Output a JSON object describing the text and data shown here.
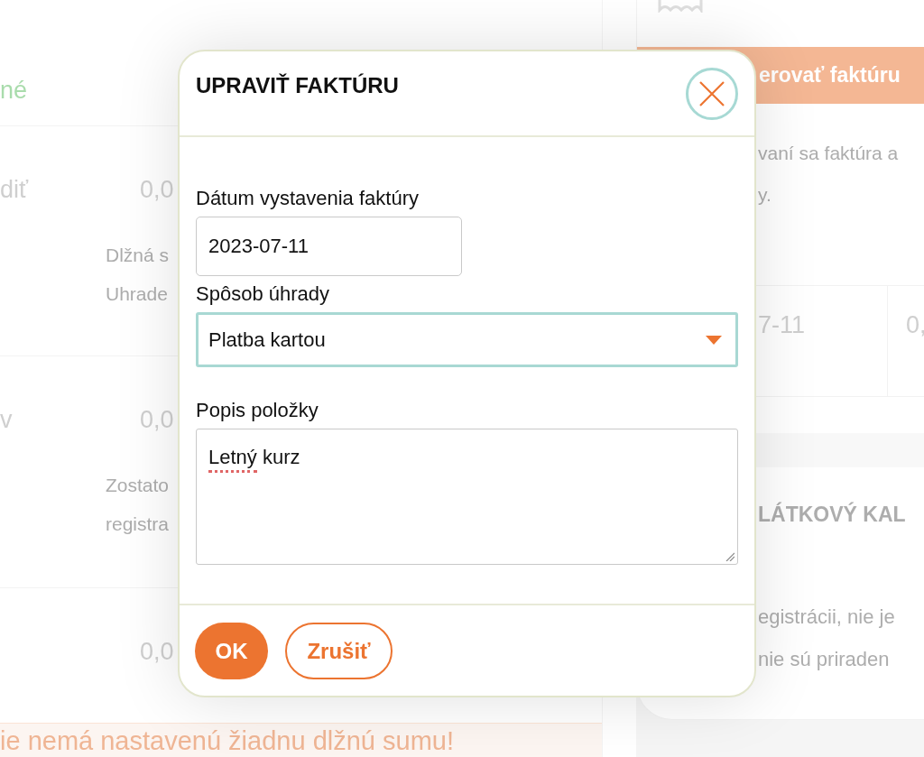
{
  "background_page": {
    "left_panel": {
      "status_label": "né",
      "rows": [
        {
          "label": "diť",
          "amount": "0,0",
          "notes": [
            "Dlžná s",
            "Uhrade"
          ]
        },
        {
          "label": "v",
          "amount": "0,0",
          "notes": [
            "Zostato",
            "registra"
          ]
        },
        {
          "amount": "0,0"
        }
      ],
      "notice": "ie nemá nastavenú žiadnu dlžnú sumu!"
    },
    "right_panel": {
      "generate_button": "erovať faktúru",
      "info_lines": [
        "vaní sa faktúra a",
        "y."
      ],
      "table_row": [
        "7-11",
        "0,"
      ],
      "section_title": "LÁTKOVÝ KAL",
      "section_lines": [
        "egistrácii, nie je",
        "nie sú priraden"
      ]
    }
  },
  "dialog": {
    "title": "UPRAVIŤ FAKTÚRU",
    "fields": [
      {
        "kind": "text",
        "label": "Dátum vystavenia faktúry",
        "value": "2023-07-11",
        "focused": false
      },
      {
        "kind": "select",
        "label": "Spôsob úhrady",
        "value": "Platba kartou",
        "focused": true
      },
      {
        "kind": "textarea",
        "label": "Popis položky",
        "words": [
          {
            "text": "Letný",
            "misspelled": true
          },
          {
            "text": "kurz",
            "misspelled": false
          }
        ],
        "focused": false
      }
    ],
    "buttons": [
      {
        "label": "OK",
        "kind": "primary"
      },
      {
        "label": "Zrušiť",
        "kind": "secondary"
      }
    ]
  }
}
